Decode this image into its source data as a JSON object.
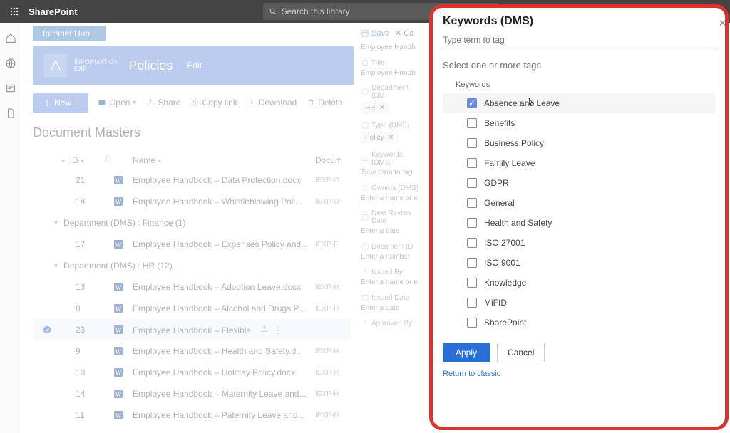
{
  "suite": {
    "app": "SharePoint",
    "search_placeholder": "Search this library"
  },
  "hub": {
    "label": "Intranet Hub"
  },
  "site": {
    "logo_top": "INFORMATION",
    "logo_bottom": "EXP",
    "title": "Policies",
    "edit": "Edit"
  },
  "cmd": {
    "new": "New",
    "open": "Open",
    "share": "Share",
    "copy": "Copy link",
    "download": "Download",
    "delete": "Delete"
  },
  "library": {
    "title": "Document Masters"
  },
  "columns": {
    "id": "ID",
    "name": "Name",
    "doc": "Docum"
  },
  "groups": [
    {
      "label": "Department (DMS) : Finance (1)"
    },
    {
      "label": "Department (DMS) : HR (12)"
    }
  ],
  "rows_top": [
    {
      "id": "21",
      "name": "Employee Handbook – Data Protection.docx",
      "tag": "IEXP-O"
    },
    {
      "id": "18",
      "name": "Employee Handbook – Whistleblowing Poli...",
      "tag": "IEXP-O"
    }
  ],
  "rows_fin": [
    {
      "id": "17",
      "name": "Employee Handbook – Expenses Policy and...",
      "tag": "IEXP-F"
    }
  ],
  "rows_hr": [
    {
      "id": "13",
      "name": "Employee Handbook – Adoption Leave.docx",
      "tag": "IEXP-H"
    },
    {
      "id": "8",
      "name": "Employee Handbook – Alcohol and Drugs P...",
      "tag": "IEXP-H"
    },
    {
      "id": "23",
      "name": "Employee Handbook – Flexible...",
      "tag": "",
      "selected": true
    },
    {
      "id": "9",
      "name": "Employee Handbook – Health and Safety.d...",
      "tag": "IEXP-H"
    },
    {
      "id": "10",
      "name": "Employee Handbook – Holiday Policy.docx",
      "tag": "IEXP-H"
    },
    {
      "id": "14",
      "name": "Employee Handbook – Maternity Leave and...",
      "tag": "IEXP-H"
    },
    {
      "id": "11",
      "name": "Employee Handbook – Paternity Leave and...",
      "tag": "IEXP-H"
    }
  ],
  "details": {
    "save": "Save",
    "cancel": "Ca",
    "crumb": "Employee Handb",
    "title_lbl": "Title",
    "title_val": "Employee Handb",
    "dept_lbl": "Department (DM",
    "dept_val": "HR",
    "type_lbl": "Type (DMS)",
    "type_val": "Policy",
    "kw_lbl": "Keywords (DMS)",
    "kw_val": "Type term to tag",
    "owners_lbl": "Owners (DMS)",
    "owners_val": "Enter a name or e",
    "review_lbl": "Next Review Date",
    "review_val": "Enter a date",
    "docid_lbl": "Document ID",
    "docid_val": "Enter a number",
    "issuedby_lbl": "Issued By",
    "issuedby_val": "Enter a name or e",
    "issueddate_lbl": "Issued Date",
    "issueddate_val": "Enter a date",
    "approved_lbl": "Approved By"
  },
  "kw": {
    "title": "Keywords (DMS)",
    "placeholder": "Type term to tag",
    "subtitle": "Select one or more tags",
    "group": "Keywords",
    "items": [
      {
        "label": "Absence and Leave",
        "checked": true,
        "highlight": true
      },
      {
        "label": "Benefits"
      },
      {
        "label": "Business Policy"
      },
      {
        "label": "Family Leave"
      },
      {
        "label": "GDPR"
      },
      {
        "label": "General"
      },
      {
        "label": "Health and Safety"
      },
      {
        "label": "ISO 27001"
      },
      {
        "label": "ISO 9001"
      },
      {
        "label": "Knowledge"
      },
      {
        "label": "MiFID"
      },
      {
        "label": "SharePoint"
      }
    ],
    "apply": "Apply",
    "cancel": "Cancel",
    "return": "Return to classic"
  }
}
